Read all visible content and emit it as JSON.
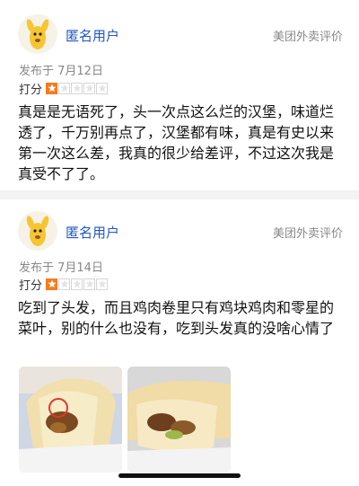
{
  "reviews": [
    {
      "username": "匿名用户",
      "source": "美团外卖评价",
      "date": "发布于 7月12日",
      "rating_label": "打分",
      "rating": 1,
      "rating_max": 5,
      "text": "真是是无语死了，头一次点这么烂的汉堡，味道烂透了，千万别再点了，汉堡都有味，真是有史以来第一次这么差，我真的很少给差评，不过这次我是真受不了了。"
    },
    {
      "username": "匿名用户",
      "source": "美团外卖评价",
      "date": "发布于 7月14日",
      "rating_label": "打分",
      "rating": 1,
      "rating_max": 5,
      "text": "吃到了头发，而且鸡肉卷里只有鸡块鸡肉和零星的菜叶，别的什么也没有，吃到头发真的没啥心情了",
      "photos": [
        "wrap-photo-with-hair-circled",
        "wrap-photo-inside"
      ]
    }
  ],
  "colors": {
    "accent": "#1f56c8",
    "star": "#f57b20",
    "circle": "#e0392b"
  }
}
